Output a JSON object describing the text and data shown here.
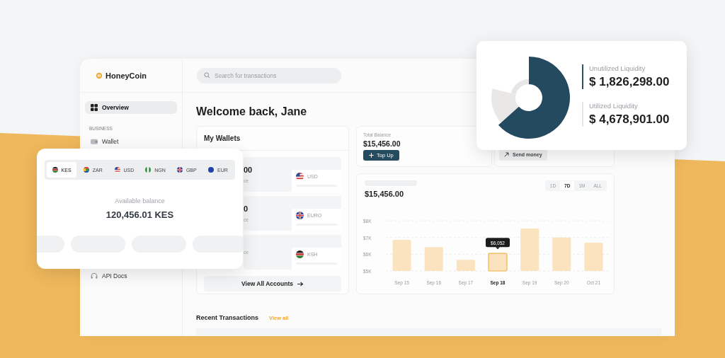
{
  "app": {
    "logo": "HoneyCoin"
  },
  "search": {
    "placeholder": "Search for transactions"
  },
  "sidebar": {
    "items": [
      {
        "label": "Overview",
        "kind": "overview",
        "selected": true
      }
    ],
    "sections": [
      {
        "title": "BUSINESS",
        "items": [
          {
            "label": "Wallet",
            "kind": "wallet",
            "selected": false
          }
        ]
      }
    ],
    "bottom_items": [
      {
        "label": "API Docs",
        "kind": "docs",
        "selected": false
      }
    ]
  },
  "greeting": "Welcome back, Jane",
  "wallets": {
    "title": "My Wallets",
    "rows": [
      {
        "amount": "00",
        "label": "ce",
        "currency": "USD",
        "kind": "us"
      },
      {
        "amount": "0",
        "label": "ce",
        "currency": "EURO",
        "kind": "gb"
      },
      {
        "label": "ce",
        "currency": "KSH",
        "kind": "ke"
      }
    ],
    "link": "View All Accounts"
  },
  "total_balance": {
    "label": "Total Balance",
    "amount": "$15,456.00",
    "button": "Top Up"
  },
  "send_money": {
    "button": "Send money"
  },
  "balance_chart": {
    "amount": "$15,456.00",
    "ranges": [
      {
        "label": "1D",
        "selected": false
      },
      {
        "label": "7D",
        "selected": true
      },
      {
        "label": "1M",
        "selected": false
      },
      {
        "label": "ALL",
        "selected": false
      }
    ],
    "chart_data": {
      "type": "bar",
      "categories": [
        "Sep 15",
        "Sep 16",
        "Sep 17",
        "Sep 18",
        "Sep 19",
        "Sep 20",
        "Oct 21"
      ],
      "values": [
        6860,
        6430,
        5670,
        6050,
        7530,
        7000,
        6690
      ],
      "ylim": [
        5000,
        8000
      ],
      "yticks": [
        {
          "value": 5000,
          "label": "$5K"
        },
        {
          "value": 6000,
          "label": "$6K"
        },
        {
          "value": 7000,
          "label": "$7K"
        },
        {
          "value": 8000,
          "label": "$8K"
        }
      ],
      "annotations": [
        {
          "x": "Sep 18",
          "text": "$6,052"
        }
      ]
    }
  },
  "recent": {
    "title": "Recent Transactions",
    "link": "View all"
  },
  "currency_card": {
    "tabs": [
      {
        "label": "KES",
        "kind": "ke",
        "selected": true
      },
      {
        "label": "ZAR",
        "kind": "za",
        "selected": false
      },
      {
        "label": "USD",
        "kind": "us",
        "selected": false
      },
      {
        "label": "NGN",
        "kind": "ng",
        "selected": false
      },
      {
        "label": "GBP",
        "kind": "gb",
        "selected": false
      },
      {
        "label": "EUR",
        "kind": "eu",
        "selected": false
      }
    ],
    "caption": "Available balance",
    "amount": "120,456.01 KES"
  },
  "liquidity": {
    "items": [
      {
        "label": "Unutilized Liquidity",
        "value": "$ 1,826,298.00",
        "highlighted": true
      },
      {
        "label": "Utilized Liquidity",
        "value": "$ 4,678,901.00",
        "highlighted": false
      }
    ]
  }
}
